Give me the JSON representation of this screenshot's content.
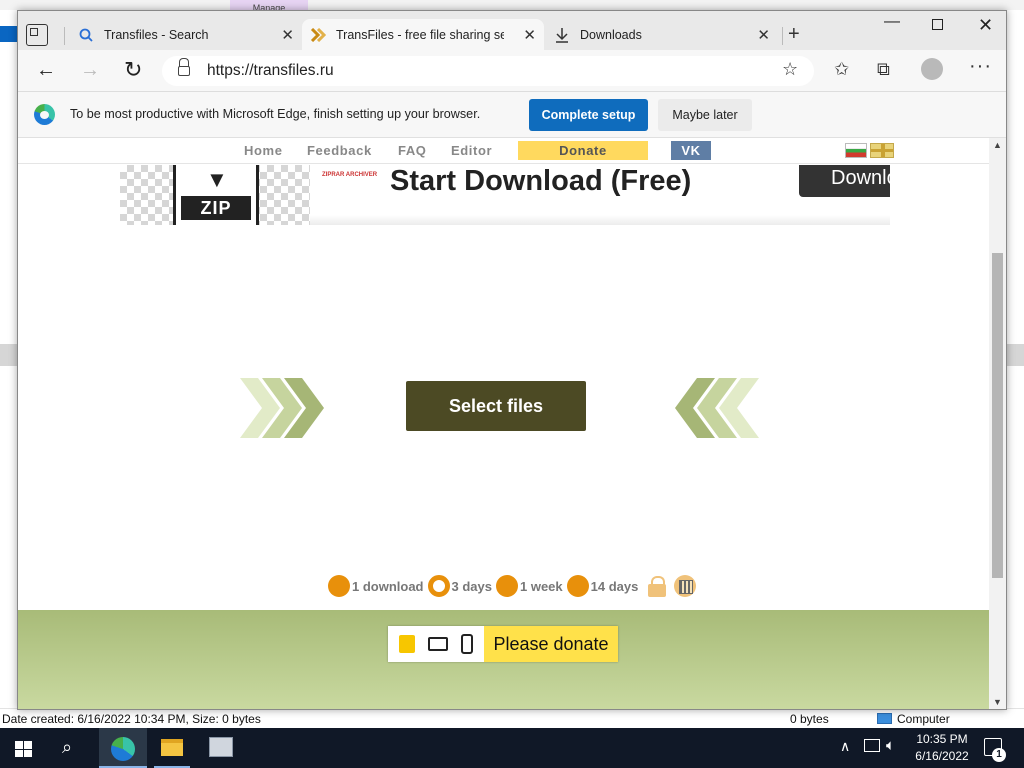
{
  "background_window": {
    "tab_text": "Manage",
    "status": {
      "date_created": "Date created: 6/16/2022 10:34 PM, Size: 0 bytes",
      "size": "0 bytes",
      "location": "Computer"
    }
  },
  "browser": {
    "tabs": [
      {
        "title": "Transfiles - Search",
        "icon": "search-icon"
      },
      {
        "title": "TransFiles - free file sharing servi",
        "icon": "transfiles-chevron-icon",
        "active": true
      },
      {
        "title": "Downloads",
        "icon": "download-icon"
      }
    ],
    "url": "https://transfiles.ru",
    "infobar": {
      "message": "To be most productive with Microsoft Edge, finish setting up your browser.",
      "primary_button": "Complete setup",
      "secondary_button": "Maybe later"
    }
  },
  "site": {
    "nav": {
      "home": "Home",
      "feedback": "Feedback",
      "faq": "FAQ",
      "editor": "Editor",
      "donate": "Donate",
      "vk": "VK"
    },
    "ad": {
      "zip_label": "ZIP",
      "brand": "ZIPRAR ARCHIVER",
      "title": "Start Download (Free)",
      "button": "Download"
    },
    "select_files": "Select files",
    "storage_options": [
      {
        "label": "1 download",
        "selected": false
      },
      {
        "label": "3 days",
        "selected": true
      },
      {
        "label": "1 week",
        "selected": false
      },
      {
        "label": "14 days",
        "selected": false
      }
    ],
    "footer": {
      "donate_label": "Please donate"
    }
  },
  "colors": {
    "select_button": "#4c4a24",
    "option_accent": "#e8900b",
    "footer_green": "#a8bb78",
    "donate_yellow": "#ffe14a"
  },
  "taskbar": {
    "time": "10:35 PM",
    "date": "6/16/2022",
    "notification_count": "1"
  }
}
